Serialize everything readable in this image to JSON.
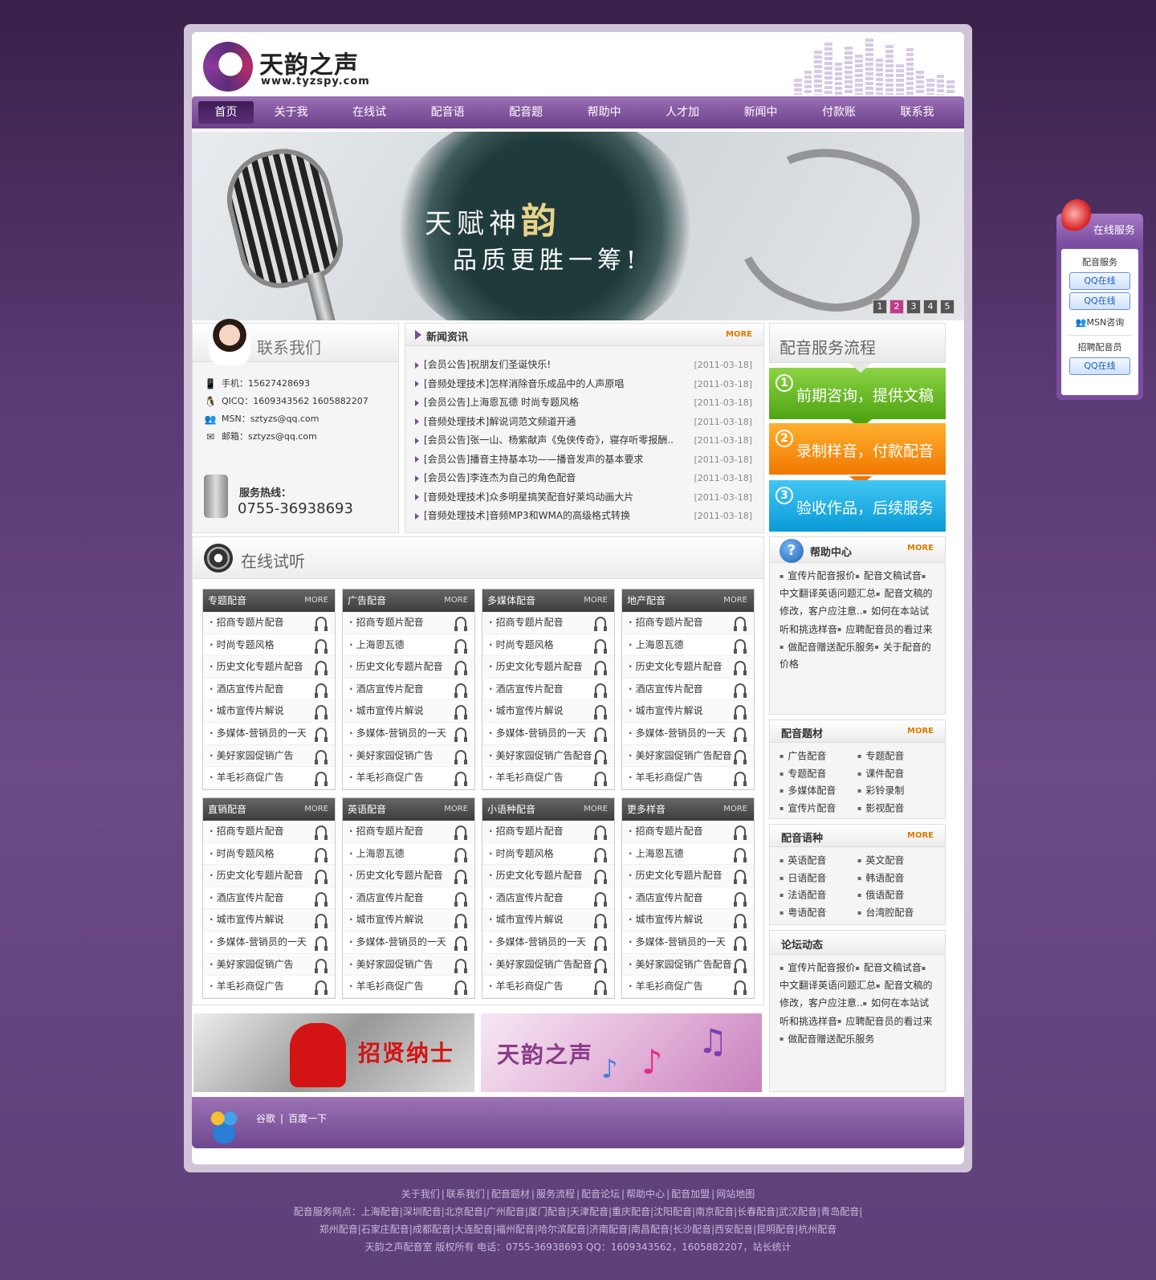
{
  "header": {
    "logo_title": "天韵之声",
    "logo_url": "www.tyzspy.com"
  },
  "nav": [
    "首页",
    "关于我们",
    "在线试听",
    "配音语种",
    "配音题材",
    "帮助中心",
    "人才加盟",
    "新闻中心",
    "付款账号",
    "联系我们"
  ],
  "banner": {
    "line1a": "天赋神",
    "line1b": "韵",
    "line2": "品质更胜一筹!",
    "pages": [
      "1",
      "2",
      "3",
      "4",
      "5"
    ],
    "active_page": "2"
  },
  "contact": {
    "title": "联系我们",
    "mobile": "手机：15627428693",
    "qq": "QICQ：1609343562 1605882207",
    "msn": "MSN：sztyzs@qq.com",
    "email": "邮箱：sztyzs@qq.com",
    "hotline_label": "服务热线：",
    "hotline": "0755-36938693"
  },
  "news": {
    "title": "新闻资讯",
    "more": "MORE",
    "items": [
      {
        "t": "[会员公告]祝朋友们圣诞快乐!",
        "d": "[2011-03-18]"
      },
      {
        "t": "[音频处理技术]怎样消除音乐成品中的人声原唱",
        "d": "[2011-03-18]"
      },
      {
        "t": "[会员公告]上海恩瓦德 时尚专题风格",
        "d": "[2011-03-18]"
      },
      {
        "t": "[音频处理技术]解说词范文频道开通",
        "d": "[2011-03-18]"
      },
      {
        "t": "[会员公告]张一山、杨紫献声《兔侠传奇》，寝存听零报酬..",
        "d": "[2011-03-18]"
      },
      {
        "t": "[会员公告]播音主持基本功——播音发声的基本要求",
        "d": "[2011-03-18]"
      },
      {
        "t": "[会员公告]李连杰为自己的角色配音",
        "d": "[2011-03-18]"
      },
      {
        "t": "[音频处理技术]众多明星搞笑配音好莱坞动画大片",
        "d": "[2011-03-18]"
      },
      {
        "t": "[音频处理技术]音频MP3和WMA的高级格式转换",
        "d": "[2011-03-18]"
      }
    ]
  },
  "flow": {
    "title": "配音服务流程",
    "steps": [
      {
        "n": "1",
        "t": "前期咨询，提供文稿"
      },
      {
        "n": "2",
        "t": "录制样音，付款配音"
      },
      {
        "n": "3",
        "t": "验收作品，后续服务"
      }
    ]
  },
  "trial": {
    "title": "在线试听",
    "more": "MORE",
    "categories": [
      {
        "name": "专题配音",
        "items": [
          "招商专题片配音",
          "时尚专题风格",
          "历史文化专题片配音",
          "酒店宣传片配音",
          "城市宣传片解说",
          "多媒体-营销员的一天",
          "美好家园促销广告",
          "羊毛衫商促广告"
        ]
      },
      {
        "name": "广告配音",
        "items": [
          "招商专题片配音",
          "上海恩瓦德",
          "历史文化专题片配音",
          "酒店宣传片配音",
          "城市宣传片解说",
          "多媒体-营销员的一天",
          "美好家园促销广告",
          "羊毛衫商促广告"
        ]
      },
      {
        "name": "多媒体配音",
        "items": [
          "招商专题片配音",
          "时尚专题风格",
          "历史文化专题片配音",
          "酒店宣传片配音",
          "城市宣传片解说",
          "多媒体-营销员的一天",
          "美好家园促销广告配音",
          "羊毛衫商促广告"
        ]
      },
      {
        "name": "地产配音",
        "items": [
          "招商专题片配音",
          "上海恩瓦德",
          "历史文化专题片配音",
          "酒店宣传片配音",
          "城市宣传片解说",
          "多媒体-营销员的一天",
          "美好家园促销广告配音",
          "羊毛衫商促广告"
        ]
      },
      {
        "name": "直销配音",
        "items": [
          "招商专题片配音",
          "时尚专题风格",
          "历史文化专题片配音",
          "酒店宣传片配音",
          "城市宣传片解说",
          "多媒体-营销员的一天",
          "美好家园促销广告",
          "羊毛衫商促广告"
        ]
      },
      {
        "name": "英语配音",
        "items": [
          "招商专题片配音",
          "上海恩瓦德",
          "历史文化专题片配音",
          "酒店宣传片配音",
          "城市宣传片解说",
          "多媒体-营销员的一天",
          "美好家园促销广告",
          "羊毛衫商促广告"
        ]
      },
      {
        "name": "小语种配音",
        "items": [
          "招商专题片配音",
          "时尚专题风格",
          "历史文化专题片配音",
          "酒店宣传片配音",
          "城市宣传片解说",
          "多媒体-营销员的一天",
          "美好家园促销广告配音",
          "羊毛衫商促广告"
        ]
      },
      {
        "name": "更多样音",
        "items": [
          "招商专题片配音",
          "上海恩瓦德",
          "历史文化专题片配音",
          "酒店宣传片配音",
          "城市宣传片解说",
          "多媒体-营销员的一天",
          "美好家园促销广告配音",
          "羊毛衫商促广告"
        ]
      }
    ]
  },
  "help": {
    "title": "帮助中心",
    "more": "MORE",
    "items": [
      "宣传片配音报价",
      "配音文稿试音",
      "中文翻译英语问题汇总",
      "配音文稿的修改，客户应注意..",
      "如何在本站试听和挑选样音",
      "应聘配音员的看过来",
      "做配音赠送配乐服务",
      "关于配音的价格"
    ]
  },
  "topics": {
    "title": "配音题材",
    "more": "MORE",
    "items": [
      "广告配音",
      "专题配音",
      "专题配音",
      "课件配音",
      "多媒体配音",
      "彩铃录制",
      "宣传片配音",
      "影视配音"
    ]
  },
  "langs": {
    "title": "配音语种",
    "more": "MORE",
    "items": [
      "英语配音",
      "英文配音",
      "日语配音",
      "韩语配音",
      "法语配音",
      "俄语配音",
      "粤语配音",
      "台湾腔配音"
    ]
  },
  "forum": {
    "title": "论坛动态",
    "items": [
      "宣传片配音报价",
      "配音文稿试音",
      "中文翻译英语问题汇总",
      "配音文稿的修改，客户应注意..",
      "如何在本站试听和挑选样音",
      "应聘配音员的看过来",
      "做配音赠送配乐服务"
    ]
  },
  "ads": {
    "recruit": "招贤纳士",
    "brand": "天韵之声"
  },
  "footer_links": {
    "google": "谷歌",
    "sep": "|",
    "baidu": "百度一下"
  },
  "bottom": {
    "links": [
      "关于我们",
      "联系我们",
      "配音题材",
      "服务流程",
      "配音论坛",
      "帮助中心",
      "配音加盟",
      "网站地图"
    ],
    "areas": "配音服务网点：上海配音|深圳配音|北京配音|广州配音|厦门配音|天津配音|重庆配音|沈阳配音|南京配音|长春配音|武汉配音|青岛配音|郑州配音|石家庄配音|成都配音|大连配音|福州配音|哈尔滨配音|济南配音|南昌配音|长沙配音|西安配音|昆明配音|杭州配音",
    "copyright": "天韵之声配音室 版权所有 电话：0755-36938693 QQ：1609343562，1605882207，站长统计"
  },
  "float": {
    "title": "在线服务",
    "label1": "配音服务",
    "qq": "QQ在线",
    "msn": "MSN咨询",
    "label2": "招聘配音员"
  },
  "colors": {
    "nav": "#7b4a9a",
    "more": "#e07a00",
    "step1": "#5cb01f",
    "step2": "#f58a00",
    "step3": "#16a8e4"
  }
}
